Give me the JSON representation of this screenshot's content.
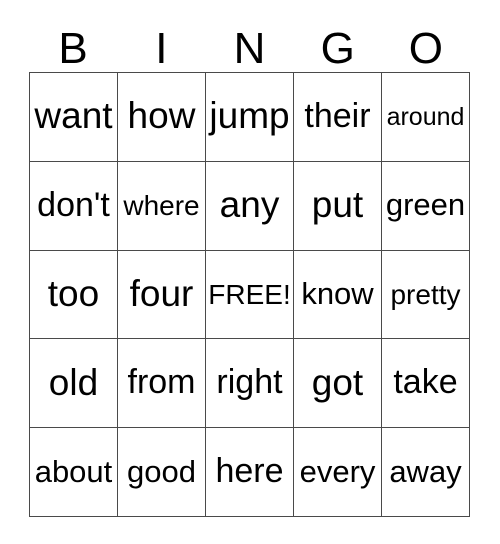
{
  "card": {
    "header_letters": [
      "B",
      "I",
      "N",
      "G",
      "O"
    ],
    "free_space_label": "FREE!",
    "border_color": "#4a4a4a",
    "background_color": "#ffffff",
    "text_color": "#000000",
    "rows": 5,
    "columns": 5
  },
  "grid": {
    "rows": [
      [
        {
          "text": "want",
          "size": "xl"
        },
        {
          "text": "how",
          "size": "xl"
        },
        {
          "text": "jump",
          "size": "xl"
        },
        {
          "text": "their",
          "size": "lg"
        },
        {
          "text": "around",
          "size": "xs"
        }
      ],
      [
        {
          "text": "don't",
          "size": "lg"
        },
        {
          "text": "where",
          "size": "sm"
        },
        {
          "text": "any",
          "size": "xl"
        },
        {
          "text": "put",
          "size": "xl"
        },
        {
          "text": "green",
          "size": "md"
        }
      ],
      [
        {
          "text": "too",
          "size": "xl"
        },
        {
          "text": "four",
          "size": "xl"
        },
        {
          "text": "FREE!",
          "size": "sm"
        },
        {
          "text": "know",
          "size": "md"
        },
        {
          "text": "pretty",
          "size": "sm"
        }
      ],
      [
        {
          "text": "old",
          "size": "xl"
        },
        {
          "text": "from",
          "size": "lg"
        },
        {
          "text": "right",
          "size": "lg"
        },
        {
          "text": "got",
          "size": "xl"
        },
        {
          "text": "take",
          "size": "lg"
        }
      ],
      [
        {
          "text": "about",
          "size": "md"
        },
        {
          "text": "good",
          "size": "md"
        },
        {
          "text": "here",
          "size": "lg"
        },
        {
          "text": "every",
          "size": "md"
        },
        {
          "text": "away",
          "size": "md"
        }
      ]
    ]
  }
}
